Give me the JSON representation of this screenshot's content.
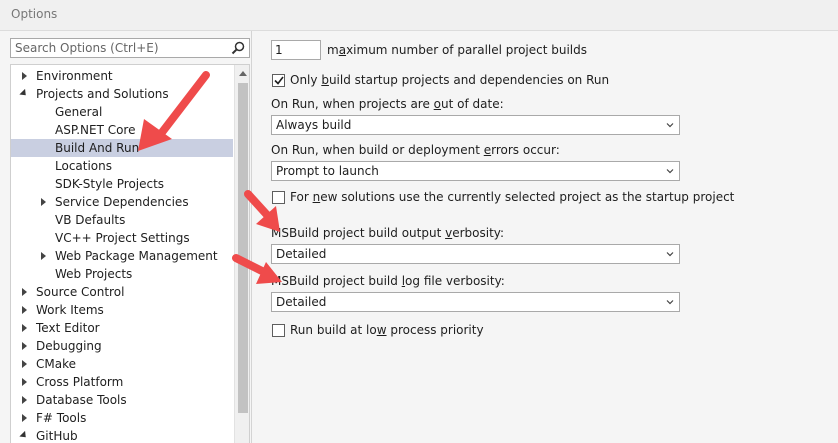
{
  "window": {
    "title": "Options"
  },
  "search": {
    "placeholder": "Search Options (Ctrl+E)"
  },
  "tree": {
    "items": [
      {
        "label": "Environment",
        "level": 0,
        "expander": "collapsed",
        "selected": false
      },
      {
        "label": "Projects and Solutions",
        "level": 0,
        "expander": "expanded",
        "selected": false
      },
      {
        "label": "General",
        "level": 1,
        "expander": "none",
        "selected": false
      },
      {
        "label": "ASP.NET Core",
        "level": 1,
        "expander": "none",
        "selected": false
      },
      {
        "label": "Build And Run",
        "level": 1,
        "expander": "none",
        "selected": true
      },
      {
        "label": "Locations",
        "level": 1,
        "expander": "none",
        "selected": false
      },
      {
        "label": "SDK-Style Projects",
        "level": 1,
        "expander": "none",
        "selected": false
      },
      {
        "label": "Service Dependencies",
        "level": 1,
        "expander": "collapsed",
        "selected": false
      },
      {
        "label": "VB Defaults",
        "level": 1,
        "expander": "none",
        "selected": false
      },
      {
        "label": "VC++ Project Settings",
        "level": 1,
        "expander": "none",
        "selected": false
      },
      {
        "label": "Web Package Management",
        "level": 1,
        "expander": "collapsed",
        "selected": false
      },
      {
        "label": "Web Projects",
        "level": 1,
        "expander": "none",
        "selected": false
      },
      {
        "label": "Source Control",
        "level": 0,
        "expander": "collapsed",
        "selected": false
      },
      {
        "label": "Work Items",
        "level": 0,
        "expander": "collapsed",
        "selected": false
      },
      {
        "label": "Text Editor",
        "level": 0,
        "expander": "collapsed",
        "selected": false
      },
      {
        "label": "Debugging",
        "level": 0,
        "expander": "collapsed",
        "selected": false
      },
      {
        "label": "CMake",
        "level": 0,
        "expander": "collapsed",
        "selected": false
      },
      {
        "label": "Cross Platform",
        "level": 0,
        "expander": "collapsed",
        "selected": false
      },
      {
        "label": "Database Tools",
        "level": 0,
        "expander": "collapsed",
        "selected": false
      },
      {
        "label": "F# Tools",
        "level": 0,
        "expander": "collapsed",
        "selected": false
      },
      {
        "label": "GitHub",
        "level": 0,
        "expander": "expanded",
        "selected": false
      }
    ]
  },
  "settings": {
    "parallel_builds": {
      "value": "1",
      "label_pre": "m",
      "label_key": "a",
      "label_post": "ximum number of parallel project builds"
    },
    "only_startup": {
      "checked": true,
      "label_pre": "Only ",
      "label_key": "b",
      "label_post": "uild startup projects and dependencies on Run"
    },
    "out_of_date": {
      "label_pre": "On Run, when projects are ",
      "label_key": "o",
      "label_post": "ut of date:",
      "selected": "Always build"
    },
    "build_errors": {
      "label_pre": "On Run, when build or deployment ",
      "label_key": "e",
      "label_post": "rrors occur:",
      "selected": "Prompt to launch"
    },
    "new_solutions": {
      "checked": false,
      "label_pre": "For ",
      "label_key": "n",
      "label_post": "ew solutions use the currently selected project as the startup project"
    },
    "output_verbosity": {
      "label_pre": "MSBuild project build output ",
      "label_key": "v",
      "label_post": "erbosity:",
      "selected": "Detailed"
    },
    "log_verbosity": {
      "label_pre": "MSBuild project build ",
      "label_key": "l",
      "label_post": "og file verbosity:",
      "selected": "Detailed"
    },
    "low_priority": {
      "checked": false,
      "label_pre": "Run build at lo",
      "label_key": "w",
      "label_post": " process priority"
    }
  },
  "colors": {
    "selection": "#c9cfe1",
    "annotation_arrow": "#ef4b4b"
  }
}
